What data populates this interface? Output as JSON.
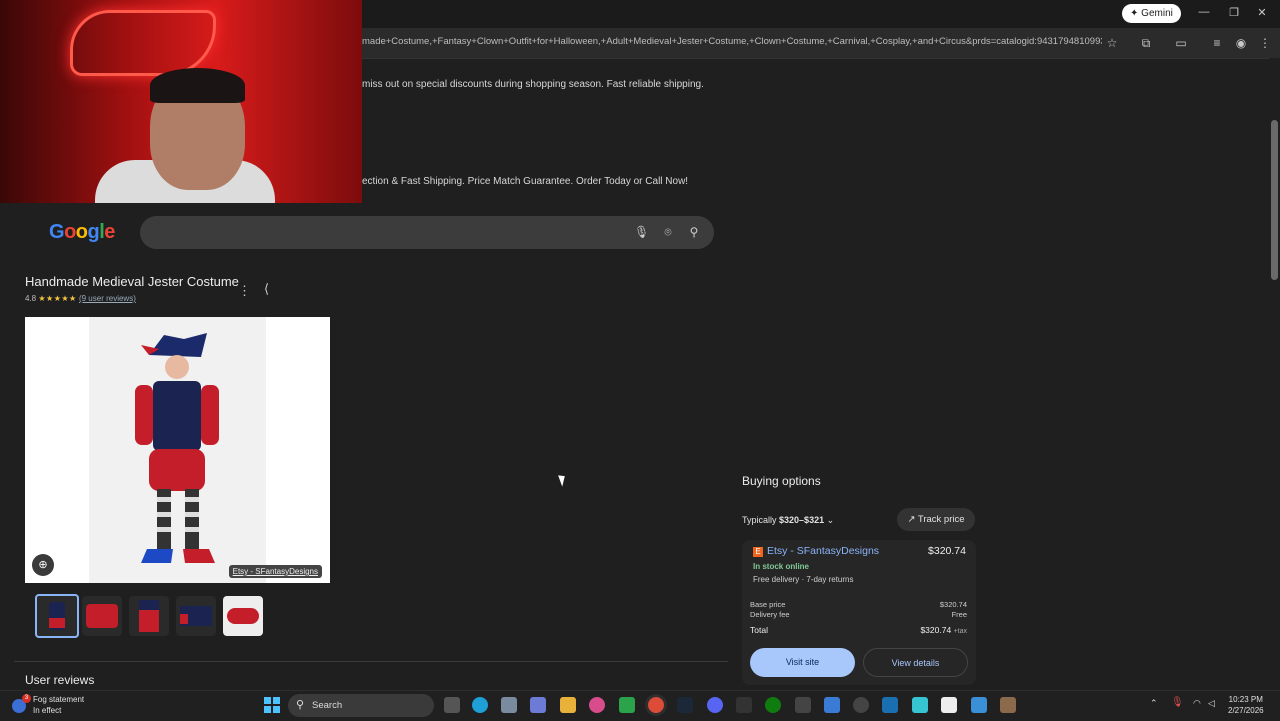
{
  "browser": {
    "url": "made+Costume,+Fantasy+Clown+Outfit+for+Halloween,+Adult+Medieval+Jester+Costume,+Clown+Costume,+Carnival,+Cosplay,+and+Circus&prds=catalogid:9431794810993...",
    "gemini_label": "Gemini"
  },
  "page": {
    "fragment1": "miss out on special discounts during shopping season. Fast reliable shipping.",
    "fragment2": "ection & Fast Shipping. Price Match Guarantee. Order Today or Call Now!",
    "google_logo": "Google",
    "search_value": ""
  },
  "product": {
    "title": "Handmade Medieval Jester Costume",
    "rating": "4.8",
    "stars": "★★★★★",
    "reviews_link": "(9 user reviews)",
    "source_badge": "Etsy - SFantasyDesigns",
    "user_reviews_heading": "User reviews"
  },
  "buying": {
    "title": "Buying options",
    "typically_label": "Typically",
    "typically_range": "$320–$321",
    "track_price": "Track price",
    "seller": "Etsy - SFantasyDesigns",
    "seller_price": "$320.74",
    "stock": "In stock online",
    "delivery": "Free delivery · 7-day returns",
    "base_price_label": "Base price",
    "base_price": "$320.74",
    "delivery_fee_label": "Delivery fee",
    "delivery_fee": "Free",
    "total_label": "Total",
    "total": "$320.74",
    "tax": "+tax",
    "visit_site": "Visit site",
    "view_details": "View details"
  },
  "taskbar": {
    "weather_title": "Fog statement",
    "weather_sub": "In effect",
    "weather_badge": "3",
    "search_label": "Search",
    "time": "10:23 PM",
    "date": "2/27/2026"
  },
  "colors": {
    "accent": "#8ab4f8",
    "stock_green": "#81c995",
    "button_fill": "#a8c7fa"
  }
}
